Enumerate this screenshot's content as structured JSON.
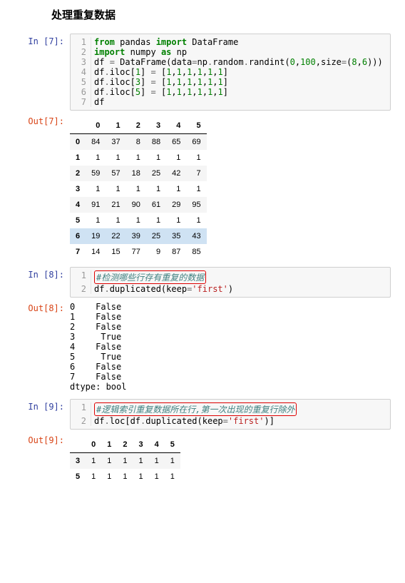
{
  "heading": "处理重复数据",
  "cell7": {
    "in_label": "In  [7]:",
    "out_label": "Out[7]:",
    "lines": [
      {
        "n": "1",
        "tokens": [
          {
            "t": "from ",
            "c": "kw-green"
          },
          {
            "t": "pandas ",
            "c": ""
          },
          {
            "t": "import ",
            "c": "kw-green"
          },
          {
            "t": "DataFrame",
            "c": ""
          }
        ]
      },
      {
        "n": "2",
        "tokens": [
          {
            "t": "import ",
            "c": "kw-green"
          },
          {
            "t": "numpy ",
            "c": ""
          },
          {
            "t": "as ",
            "c": "kw-green"
          },
          {
            "t": "np",
            "c": ""
          }
        ]
      },
      {
        "n": "3",
        "tokens": [
          {
            "t": "df ",
            "c": ""
          },
          {
            "t": "= ",
            "c": "op"
          },
          {
            "t": "DataFrame(data",
            "c": ""
          },
          {
            "t": "=",
            "c": "op"
          },
          {
            "t": "np",
            "c": ""
          },
          {
            "t": ".",
            "c": "op"
          },
          {
            "t": "random",
            "c": ""
          },
          {
            "t": ".",
            "c": "op"
          },
          {
            "t": "randint(",
            "c": ""
          },
          {
            "t": "0",
            "c": "num"
          },
          {
            "t": ",",
            "c": ""
          },
          {
            "t": "100",
            "c": "num"
          },
          {
            "t": ",size",
            "c": ""
          },
          {
            "t": "=",
            "c": "op"
          },
          {
            "t": "(",
            "c": ""
          },
          {
            "t": "8",
            "c": "num"
          },
          {
            "t": ",",
            "c": ""
          },
          {
            "t": "6",
            "c": "num"
          },
          {
            "t": ")))",
            "c": ""
          }
        ]
      },
      {
        "n": "4",
        "tokens": [
          {
            "t": "df",
            "c": ""
          },
          {
            "t": ".",
            "c": "op"
          },
          {
            "t": "iloc[",
            "c": ""
          },
          {
            "t": "1",
            "c": "num"
          },
          {
            "t": "] ",
            "c": ""
          },
          {
            "t": "= ",
            "c": "op"
          },
          {
            "t": "[",
            "c": ""
          },
          {
            "t": "1",
            "c": "num"
          },
          {
            "t": ",",
            "c": ""
          },
          {
            "t": "1",
            "c": "num"
          },
          {
            "t": ",",
            "c": ""
          },
          {
            "t": "1",
            "c": "num"
          },
          {
            "t": ",",
            "c": ""
          },
          {
            "t": "1",
            "c": "num"
          },
          {
            "t": ",",
            "c": ""
          },
          {
            "t": "1",
            "c": "num"
          },
          {
            "t": ",",
            "c": ""
          },
          {
            "t": "1",
            "c": "num"
          },
          {
            "t": "]",
            "c": ""
          }
        ]
      },
      {
        "n": "5",
        "tokens": [
          {
            "t": "df",
            "c": ""
          },
          {
            "t": ".",
            "c": "op"
          },
          {
            "t": "iloc[",
            "c": ""
          },
          {
            "t": "3",
            "c": "num"
          },
          {
            "t": "] ",
            "c": ""
          },
          {
            "t": "= ",
            "c": "op"
          },
          {
            "t": "[",
            "c": ""
          },
          {
            "t": "1",
            "c": "num"
          },
          {
            "t": ",",
            "c": ""
          },
          {
            "t": "1",
            "c": "num"
          },
          {
            "t": ",",
            "c": ""
          },
          {
            "t": "1",
            "c": "num"
          },
          {
            "t": ",",
            "c": ""
          },
          {
            "t": "1",
            "c": "num"
          },
          {
            "t": ",",
            "c": ""
          },
          {
            "t": "1",
            "c": "num"
          },
          {
            "t": ",",
            "c": ""
          },
          {
            "t": "1",
            "c": "num"
          },
          {
            "t": "]",
            "c": ""
          }
        ]
      },
      {
        "n": "6",
        "tokens": [
          {
            "t": "df",
            "c": ""
          },
          {
            "t": ".",
            "c": "op"
          },
          {
            "t": "iloc[",
            "c": ""
          },
          {
            "t": "5",
            "c": "num"
          },
          {
            "t": "] ",
            "c": ""
          },
          {
            "t": "= ",
            "c": "op"
          },
          {
            "t": "[",
            "c": ""
          },
          {
            "t": "1",
            "c": "num"
          },
          {
            "t": ",",
            "c": ""
          },
          {
            "t": "1",
            "c": "num"
          },
          {
            "t": ",",
            "c": ""
          },
          {
            "t": "1",
            "c": "num"
          },
          {
            "t": ",",
            "c": ""
          },
          {
            "t": "1",
            "c": "num"
          },
          {
            "t": ",",
            "c": ""
          },
          {
            "t": "1",
            "c": "num"
          },
          {
            "t": ",",
            "c": ""
          },
          {
            "t": "1",
            "c": "num"
          },
          {
            "t": "]",
            "c": ""
          }
        ]
      },
      {
        "n": "7",
        "tokens": [
          {
            "t": "df",
            "c": ""
          }
        ]
      }
    ],
    "table": {
      "cols": [
        "0",
        "1",
        "2",
        "3",
        "4",
        "5"
      ],
      "rows": [
        {
          "idx": "0",
          "v": [
            "84",
            "37",
            "8",
            "88",
            "65",
            "69"
          ],
          "hl": false
        },
        {
          "idx": "1",
          "v": [
            "1",
            "1",
            "1",
            "1",
            "1",
            "1"
          ],
          "hl": false
        },
        {
          "idx": "2",
          "v": [
            "59",
            "57",
            "18",
            "25",
            "42",
            "7"
          ],
          "hl": false
        },
        {
          "idx": "3",
          "v": [
            "1",
            "1",
            "1",
            "1",
            "1",
            "1"
          ],
          "hl": false
        },
        {
          "idx": "4",
          "v": [
            "91",
            "21",
            "90",
            "61",
            "29",
            "95"
          ],
          "hl": false
        },
        {
          "idx": "5",
          "v": [
            "1",
            "1",
            "1",
            "1",
            "1",
            "1"
          ],
          "hl": false
        },
        {
          "idx": "6",
          "v": [
            "19",
            "22",
            "39",
            "25",
            "35",
            "43"
          ],
          "hl": true
        },
        {
          "idx": "7",
          "v": [
            "14",
            "15",
            "77",
            "9",
            "87",
            "85"
          ],
          "hl": false
        }
      ]
    }
  },
  "cell8": {
    "in_label": "In  [8]:",
    "out_label": "Out[8]:",
    "lines": [
      {
        "n": "1",
        "tokens": [
          {
            "t": "#检测哪些行存有重复的数据",
            "c": "cmt",
            "box": true
          }
        ]
      },
      {
        "n": "2",
        "tokens": [
          {
            "t": "df",
            "c": ""
          },
          {
            "t": ".",
            "c": "op"
          },
          {
            "t": "duplicated(keep",
            "c": ""
          },
          {
            "t": "=",
            "c": "op"
          },
          {
            "t": "'first'",
            "c": "str"
          },
          {
            "t": ")",
            "c": ""
          }
        ]
      }
    ],
    "output": "0    False\n1    False\n2    False\n3     True\n4    False\n5     True\n6    False\n7    False\ndtype: bool"
  },
  "cell9": {
    "in_label": "In  [9]:",
    "out_label": "Out[9]:",
    "lines": [
      {
        "n": "1",
        "tokens": [
          {
            "t": "#逻辑索引重复数据所在行,第一次出现的重复行除外",
            "c": "cmt",
            "box": true
          }
        ]
      },
      {
        "n": "2",
        "tokens": [
          {
            "t": "df",
            "c": ""
          },
          {
            "t": ".",
            "c": "op"
          },
          {
            "t": "loc[df",
            "c": ""
          },
          {
            "t": ".",
            "c": "op"
          },
          {
            "t": "duplicated(keep",
            "c": ""
          },
          {
            "t": "=",
            "c": "op"
          },
          {
            "t": "'first'",
            "c": "str"
          },
          {
            "t": ")]",
            "c": ""
          }
        ]
      }
    ],
    "table": {
      "cols": [
        "0",
        "1",
        "2",
        "3",
        "4",
        "5"
      ],
      "rows": [
        {
          "idx": "3",
          "v": [
            "1",
            "1",
            "1",
            "1",
            "1",
            "1"
          ],
          "hl": false
        },
        {
          "idx": "5",
          "v": [
            "1",
            "1",
            "1",
            "1",
            "1",
            "1"
          ],
          "hl": false
        }
      ]
    }
  }
}
